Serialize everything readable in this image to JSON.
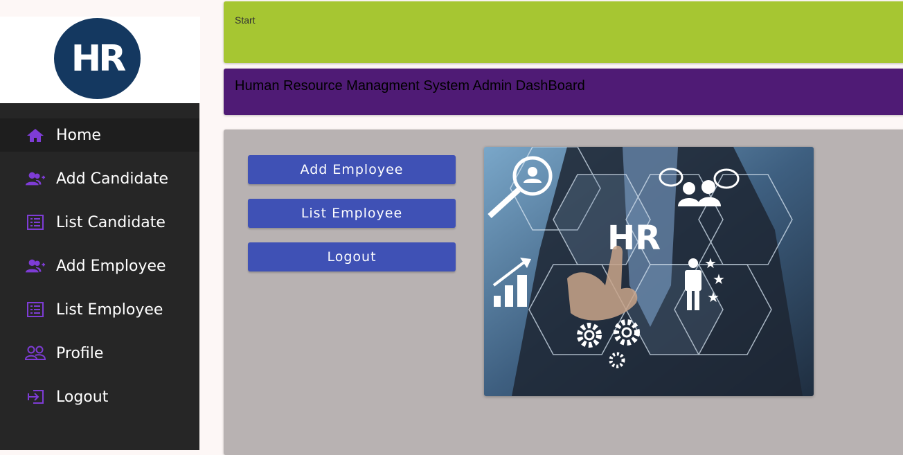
{
  "logo": {
    "text": "HR"
  },
  "sidebar": {
    "items": [
      {
        "label": "Home",
        "icon": "home-icon"
      },
      {
        "label": "Add Candidate",
        "icon": "person-add-icon"
      },
      {
        "label": "List Candidate",
        "icon": "list-icon"
      },
      {
        "label": "Add Employee",
        "icon": "person-add-icon"
      },
      {
        "label": "List Employee",
        "icon": "list-icon"
      },
      {
        "label": "Profile",
        "icon": "people-icon"
      },
      {
        "label": "Logout",
        "icon": "logout-icon"
      }
    ]
  },
  "header": {
    "start_label": "Start",
    "title": "Human Resource Managment System Admin DashBoard"
  },
  "main": {
    "buttons": [
      {
        "label": "Add Employee"
      },
      {
        "label": "List Employee"
      },
      {
        "label": "Logout"
      }
    ],
    "image_text": "HR"
  },
  "colors": {
    "accent_icon": "#7e3cd6",
    "start_bar": "#a6c632",
    "title_bar": "#4f1b75",
    "button": "#3f51b5",
    "sidebar": "#262626",
    "panel": "#b8b2b2"
  }
}
